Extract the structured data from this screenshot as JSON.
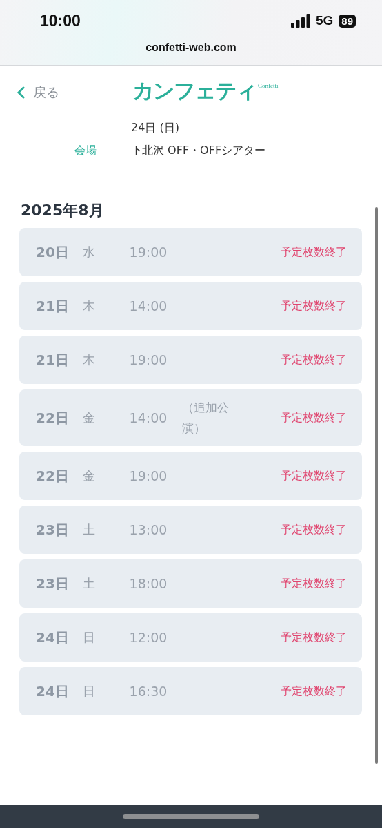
{
  "status_bar": {
    "time": "10:00",
    "network": "5G",
    "battery": "89"
  },
  "browser": {
    "url": "confetti-web.com"
  },
  "header": {
    "back": "戻る",
    "logo": "カンフェティ",
    "logo_sub": "Confetti",
    "date": "24日 (日)",
    "venue_label": "会場",
    "venue": "下北沢 OFF・OFFシアター"
  },
  "month": "2025年8月",
  "performances": [
    {
      "day": "20日",
      "weekday": "水",
      "time": "19:00",
      "status": "予定枚数終了"
    },
    {
      "day": "21日",
      "weekday": "木",
      "time": "14:00",
      "status": "予定枚数終了"
    },
    {
      "day": "21日",
      "weekday": "木",
      "time": "19:00",
      "status": "予定枚数終了"
    },
    {
      "day": "22日",
      "weekday": "金",
      "time": "14:00",
      "note": "（追加公演）",
      "status": "予定枚数終了"
    },
    {
      "day": "22日",
      "weekday": "金",
      "time": "19:00",
      "status": "予定枚数終了"
    },
    {
      "day": "23日",
      "weekday": "土",
      "time": "13:00",
      "status": "予定枚数終了"
    },
    {
      "day": "23日",
      "weekday": "土",
      "time": "18:00",
      "status": "予定枚数終了"
    },
    {
      "day": "24日",
      "weekday": "日",
      "time": "12:00",
      "status": "予定枚数終了"
    },
    {
      "day": "24日",
      "weekday": "日",
      "time": "16:30",
      "status": "予定枚数終了"
    }
  ]
}
